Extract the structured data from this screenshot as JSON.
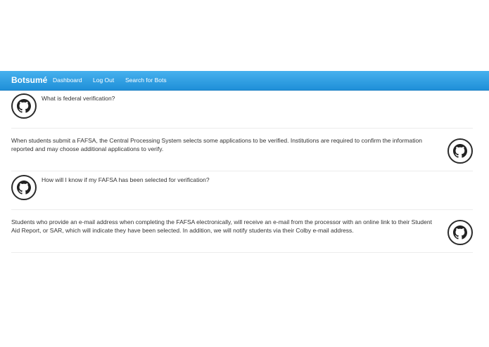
{
  "navbar": {
    "brand": "Botsumé",
    "links": [
      "Dashboard",
      "Log Out",
      "Search for Bots"
    ]
  },
  "conversation": [
    {
      "role": "question",
      "text": "What is federal verification?",
      "avatar_icon": "github-octocat-icon"
    },
    {
      "role": "answer",
      "text": "When students submit a FAFSA, the Central Processing System selects some applications to be verified. Institutions are required to confirm the information reported and may choose additional applications to verify.",
      "avatar_icon": "github-octocat-icon"
    },
    {
      "role": "question",
      "text": "How will I know if my FAFSA has been selected for verification?",
      "avatar_icon": "github-octocat-icon"
    },
    {
      "role": "answer",
      "text": "Students who provide an e-mail address when completing the FAFSA electronically, will receive an e-mail from the processor with an online link to their Student Aid Report, or SAR, which will indicate they have been selected. In addition, we will notify students via their Colby e-mail address.",
      "avatar_icon": "github-octocat-icon"
    }
  ],
  "colors": {
    "navbar_top": "#47b1ee",
    "navbar_bottom": "#1f8fd8",
    "text": "#333333"
  }
}
